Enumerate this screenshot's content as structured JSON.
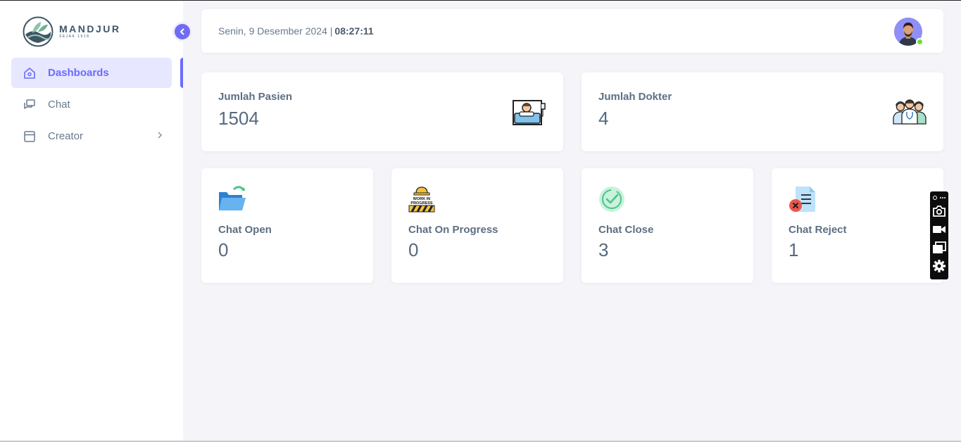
{
  "brand": {
    "name": "MANDJUR",
    "tagline": "SEJAK 1918"
  },
  "sidebar": {
    "items": [
      {
        "label": "Dashboards",
        "icon": "home-icon",
        "active": true
      },
      {
        "label": "Chat",
        "icon": "chat-icon",
        "active": false
      },
      {
        "label": "Creator",
        "icon": "window-icon",
        "active": false,
        "has_submenu": true
      }
    ]
  },
  "navbar": {
    "date": "Senin, 9 Desember 2024 |",
    "time": "08:27:11"
  },
  "stats": {
    "patients": {
      "label": "Jumlah Pasien",
      "value": "1504",
      "icon": "patient-bed-icon"
    },
    "doctors": {
      "label": "Jumlah Dokter",
      "value": "4",
      "icon": "doctors-group-icon"
    },
    "chat_open": {
      "label": "Chat Open",
      "value": "0",
      "icon": "open-folder-icon"
    },
    "chat_progress": {
      "label": "Chat On Progress",
      "value": "0",
      "icon": "work-in-progress-icon",
      "icon_text": "WORK IN PROGRESS"
    },
    "chat_close": {
      "label": "Chat Close",
      "value": "3",
      "icon": "check-circle-icon"
    },
    "chat_reject": {
      "label": "Chat Reject",
      "value": "1",
      "icon": "rejected-document-icon"
    }
  },
  "colors": {
    "accent": "#696cff",
    "active_bg": "#e7e7ff",
    "page_bg": "#f5f5f9",
    "online": "#71dd37"
  },
  "toolbar": {
    "icons": [
      "more-icon",
      "camera-icon",
      "video-icon",
      "copy-icon",
      "settings-icon"
    ]
  }
}
